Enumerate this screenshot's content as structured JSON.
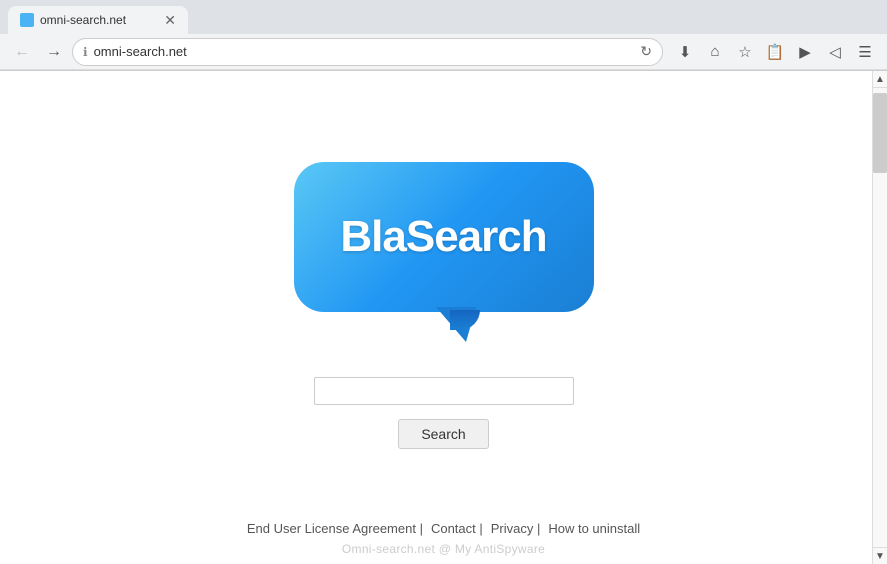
{
  "browser": {
    "tab_title": "omni-search.net",
    "address": "omni-search.net"
  },
  "nav": {
    "back_label": "◀",
    "forward_label": "▶",
    "home_label": "⌂",
    "refresh_label": "↻",
    "download_label": "⬇",
    "bookmark_label": "★",
    "readinglist_label": "📋",
    "pocket_label": "🅟",
    "back_arrow": "⬅",
    "forward_arrow": "⬅",
    "menu_label": "☰"
  },
  "logo": {
    "text": "BlaSearch"
  },
  "search": {
    "input_placeholder": "",
    "button_label": "Search"
  },
  "footer": {
    "links": [
      {
        "label": "End User License Agreement |",
        "name": "eula-link"
      },
      {
        "label": "Contact |",
        "name": "contact-link"
      },
      {
        "label": "Privacy |",
        "name": "privacy-link"
      },
      {
        "label": "How to uninstall",
        "name": "uninstall-link"
      }
    ]
  },
  "watermark": {
    "text": "Omni-search.net @ My AntiSpyware"
  }
}
